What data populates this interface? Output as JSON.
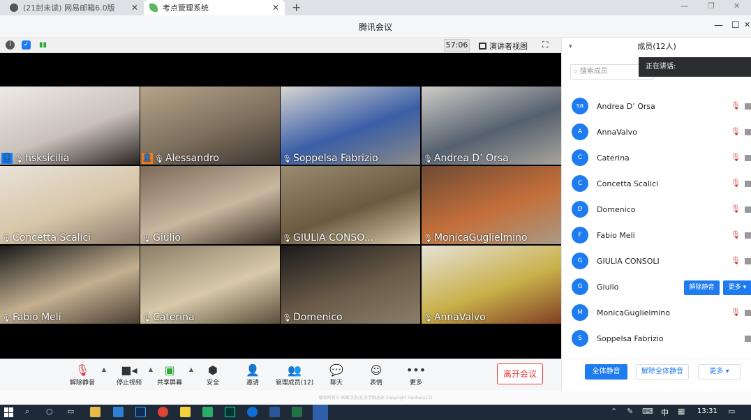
{
  "browser": {
    "tabs": [
      {
        "label": "(21封未读) 网易邮箱6.0版",
        "close": "✕"
      },
      {
        "label": "考点管理系统",
        "close": "✕"
      }
    ],
    "new_tab": "+",
    "window_controls": [
      "—",
      "❐",
      "✕"
    ]
  },
  "app": {
    "title": "腾讯会议",
    "window_controls": [
      "—",
      "☐",
      "✕"
    ]
  },
  "infobar": {
    "timer": "57:06",
    "speaker_view": "演讲者视图",
    "fullscreen": "⛶"
  },
  "videos": [
    {
      "name": "hsksicilia",
      "host": "blue",
      "colors": [
        "#eeeae6",
        "#c9c2bb",
        "#2a2320"
      ]
    },
    {
      "name": "Alessandro",
      "host": "orange",
      "colors": [
        "#b6a58a",
        "#7d6f5d",
        "#3d3530"
      ]
    },
    {
      "name": "Soppelsa Fabrizio",
      "colors": [
        "#d8d6d2",
        "#3a5ea6",
        "#8b8a86"
      ]
    },
    {
      "name": "Andrea D’ Orsa",
      "colors": [
        "#cfccc7",
        "#55606f",
        "#a8a49c"
      ]
    },
    {
      "name": "Concetta Scalici",
      "colors": [
        "#e9e2d8",
        "#d6c6a8",
        "#8c7a6a"
      ]
    },
    {
      "name": "Giulio",
      "colors": [
        "#7a6a58",
        "#c9b8a0",
        "#3b2f25"
      ]
    },
    {
      "name": "GIULIA CONSO...",
      "colors": [
        "#9a8c70",
        "#6b5a40",
        "#d8c9a8"
      ]
    },
    {
      "name": "MonicaGuglielmino",
      "colors": [
        "#6e4a34",
        "#c46f3a",
        "#a89a86"
      ]
    },
    {
      "name": "Fabio Meli",
      "colors": [
        "#1a1a1a",
        "#c4b090",
        "#4c3f34"
      ]
    },
    {
      "name": "Caterina",
      "colors": [
        "#8a7e68",
        "#d7c9a9",
        "#5a4e3c"
      ]
    },
    {
      "name": "Domenico",
      "colors": [
        "#1a1a1a",
        "#6a5a48",
        "#8c7d6a"
      ]
    },
    {
      "name": "AnnaValvo",
      "colors": [
        "#e5e2d8",
        "#c9b04a",
        "#7f3f24"
      ]
    }
  ],
  "toolbar": {
    "unmute": "解除静音",
    "stop_video": "停止视频",
    "share_screen": "共享屏幕",
    "security": "安全",
    "invite": "邀请",
    "manage_members": "管理成员(12)",
    "chat": "聊天",
    "emoji": "表情",
    "more": "更多",
    "leave": "离开会议"
  },
  "copyright": "版权所有© 国家汉办/孔子学院总部 Copyright Hanban/CTI",
  "panel": {
    "title": "成员(12人)",
    "search_placeholder": "搜索成员",
    "speaking": "正在讲话:",
    "members": [
      {
        "initials": "sa",
        "name": "Andrea D’ Orsa",
        "muted": true
      },
      {
        "initials": "A",
        "name": "AnnaValvo",
        "muted": true
      },
      {
        "initials": "C",
        "name": "Caterina",
        "muted": true
      },
      {
        "initials": "C",
        "name": "Concetta Scalici",
        "muted": true
      },
      {
        "initials": "D",
        "name": "Domenico",
        "muted": true
      },
      {
        "initials": "F",
        "name": "Fabio Meli",
        "muted": true
      },
      {
        "initials": "G",
        "name": "GIULIA CONSOLI",
        "muted": true
      },
      {
        "initials": "G",
        "name": "Giulio",
        "muted": false
      },
      {
        "initials": "M",
        "name": "MonicaGuglielmino",
        "muted": true
      },
      {
        "initials": "S",
        "name": "Soppelsa Fabrizio",
        "muted": false
      }
    ],
    "unmute_btn": "解除静音",
    "more_btn": "更多 ▾",
    "mute_all": "全体静音",
    "unmute_all": "解除全体静音",
    "footer_more": "更多 ▾"
  },
  "taskbar": {
    "ime": "中",
    "time": "13:31"
  }
}
